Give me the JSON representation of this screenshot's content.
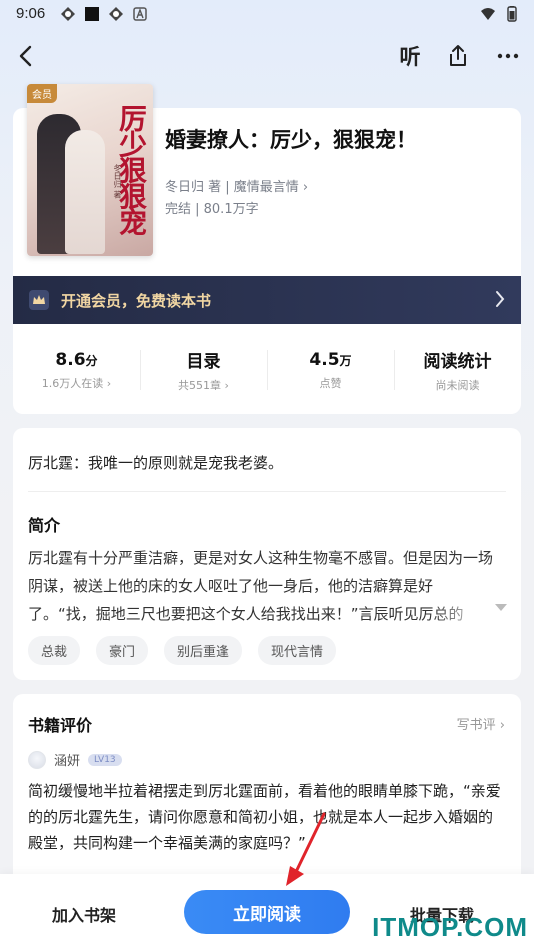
{
  "status_bar": {
    "time": "9:06"
  },
  "nav": {
    "listen_label": "听"
  },
  "book": {
    "cover_tag": "会员",
    "cover_title": "厉少狠狠宠",
    "cover_author": "冬日归 著",
    "title": "婚妻撩人：厉少，狠狠宠！",
    "author_line": "冬日归 著 | 魔情最言情",
    "status_line": "完结 | 80.1万字"
  },
  "vip": {
    "label": "开通会员，免费读本书"
  },
  "stats": [
    {
      "value": "8.6",
      "unit": "分",
      "sub": "1.6万人在读",
      "arrow": "›"
    },
    {
      "value": "目录",
      "unit": "",
      "sub": "共551章",
      "arrow": "›"
    },
    {
      "value": "4.5",
      "unit": "万",
      "sub": "点赞",
      "arrow": ""
    },
    {
      "value": "阅读统计",
      "unit": "",
      "sub": "尚未阅读",
      "arrow": ""
    }
  ],
  "intro": {
    "quote": "厉北霆：我唯一的原则就是宠我老婆。",
    "title": "简介",
    "text": "厉北霆有十分严重洁癖，更是对女人这种生物毫不感冒。但是因为一场阴谋，被送上他的床的女人呕吐了他一身后，他的洁癖算是好了。“找，掘地三尺也要把这个女人给我找出来！”言辰听见厉总的",
    "tags": [
      "总裁",
      "豪门",
      "别后重逢",
      "现代言情"
    ]
  },
  "reviews": {
    "title": "书籍评价",
    "write_label": "写书评",
    "reviewer_name": "涵妍",
    "reviewer_level": "LV13",
    "text": "简初缓慢地半拉着裙摆走到厉北霆面前，看着他的眼睛单膝下跪，“亲爱的的厉北霆先生，请问你愿意和简初小姐，也就是本人一起步入婚姻的殿堂，共同构建一个幸福美满的家庭吗？”"
  },
  "bottom": {
    "add_shelf": "加入书架",
    "read_now": "立即阅读",
    "batch_download": "批量下载"
  },
  "watermark": "ITMOP.COM",
  "colors": {
    "accent": "#2f7cf0",
    "vip_bg": "#242b45",
    "vip_text": "#f1d6a3",
    "annotation": "#e0242b"
  }
}
